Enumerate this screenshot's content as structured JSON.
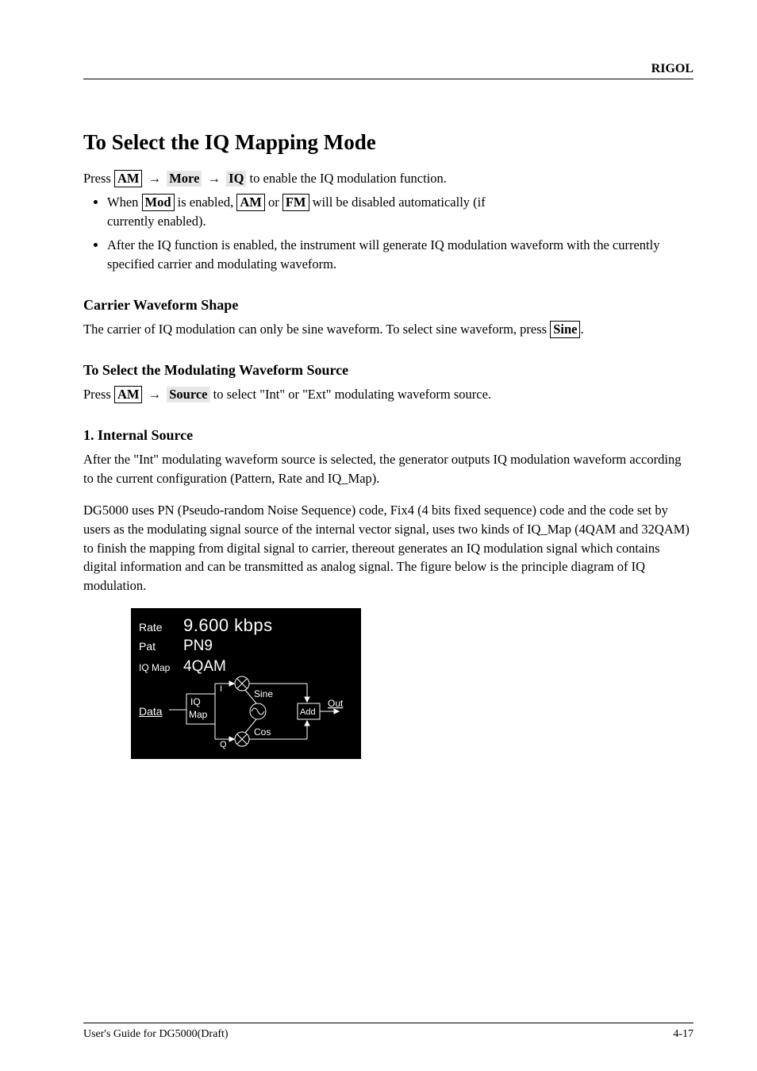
{
  "header": {
    "brand": "RIGOL"
  },
  "section": {
    "title": "To Select the IQ Mapping Mode",
    "intro_prefix": "Press ",
    "intro_k1": "AM",
    "intro_s1": "More",
    "intro_s2": "IQ",
    "intro_suffix": " to enable the IQ modulation function.",
    "bullets": [
      {
        "text_prefix": "When ",
        "box": "Mod",
        "text_mid": " is enabled, ",
        "box2": "AM",
        "text_or": " or ",
        "box3": "FM",
        "text_suffix_l1": " will be disabled automatically (if",
        "text_suffix_l2": "currently enabled)."
      },
      {
        "plain": "After the IQ function is enabled, the instrument will generate IQ modulation waveform with the currently specified carrier and modulating waveform."
      }
    ]
  },
  "carrier": {
    "heading": "Carrier Waveform Shape",
    "p1": "The carrier of IQ modulation can only be sine waveform. To select sine waveform, press",
    "box": "Sine",
    "p1_suffix": "."
  },
  "modwave": {
    "heading": "To Select the Modulating Waveform Source",
    "p1_prefix": "Press ",
    "p1_k1": "AM",
    "p1_s1": "Source",
    "p1_suffix": " to select \"Int\" or \"Ext\" modulating waveform source."
  },
  "internal": {
    "heading": "1. Internal Source",
    "p1": "After the \"Int\" modulating waveform source is selected, the generator outputs IQ modulation waveform according to the current configuration (Pattern, Rate and IQ_Map).",
    "p2": "DG5000 uses PN (Pseudo-random Noise Sequence) code, Fix4 (4 bits fixed sequence) code and the code set by users as the modulating signal source of the internal vector signal, uses two kinds of IQ_Map (4QAM and 32QAM) to finish the mapping from digital signal to carrier, thereout generates an IQ modulation signal which contains digital information and can be transmitted as analog signal. The figure below is the principle diagram of IQ modulation."
  },
  "lcd": {
    "rate_label": "Rate",
    "rate_value": "9.600 kbps",
    "pat_label": "Pat",
    "pat_value": "PN9",
    "iqmap_label": "IQ Map",
    "iqmap_value": "4QAM",
    "data_label": "Data",
    "iq_block": "IQ",
    "map_block": "Map",
    "sine": "Sine",
    "cos": "Cos",
    "add": "Add",
    "out": "Out",
    "i": "I",
    "q": "Q"
  },
  "footer": {
    "left": "User's Guide for DG5000(Draft)",
    "right": "4-17"
  }
}
